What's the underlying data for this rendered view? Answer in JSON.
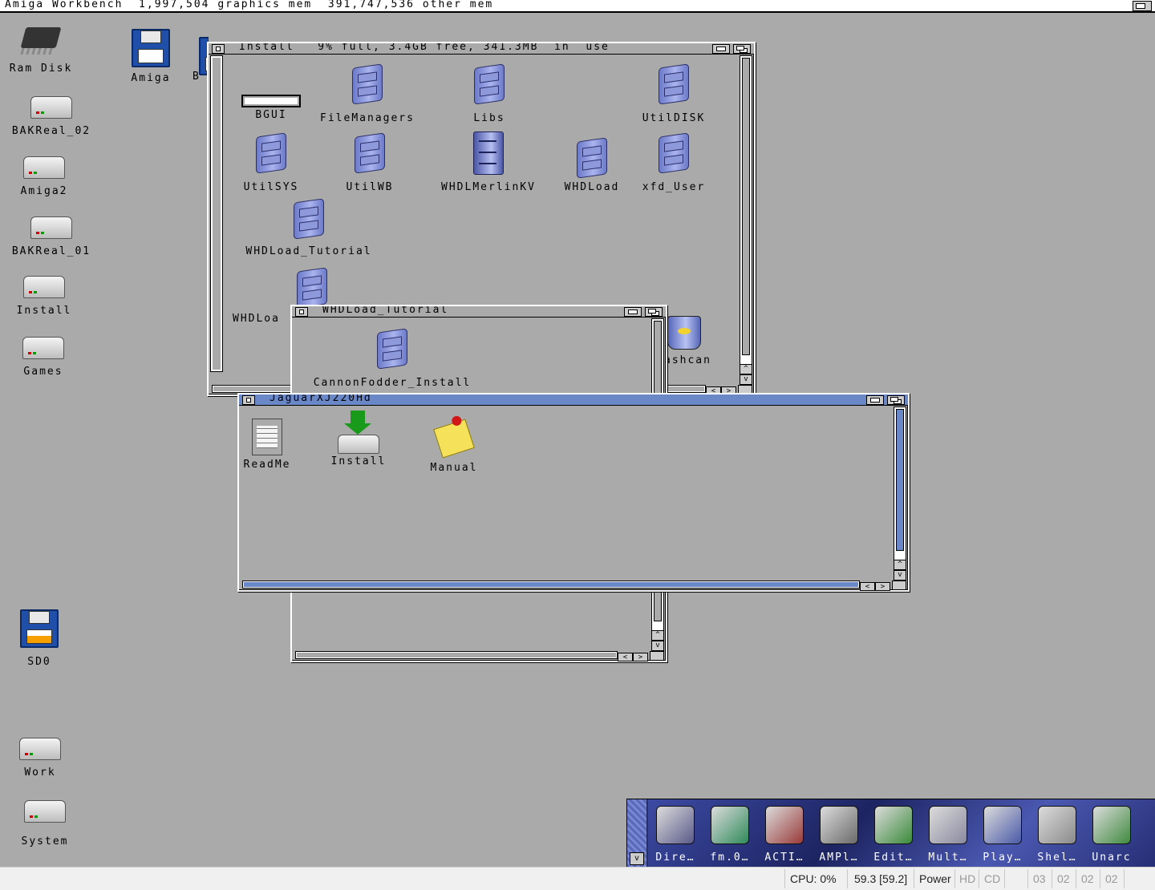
{
  "screen": {
    "title": "Amiga Workbench  1,997,504 graphics mem  391,747,536 other mem"
  },
  "desktop_icons": [
    {
      "label": "Ram Disk",
      "kind": "ram"
    },
    {
      "label": "Amiga",
      "kind": "floppy"
    },
    {
      "label": "B",
      "kind": "floppy"
    },
    {
      "label": "BAKReal_02",
      "kind": "drive"
    },
    {
      "label": "Amiga2",
      "kind": "drive"
    },
    {
      "label": "BAKReal_01",
      "kind": "drive"
    },
    {
      "label": "Install",
      "kind": "drive"
    },
    {
      "label": "Games",
      "kind": "drive"
    },
    {
      "label": "SD0",
      "kind": "floppy"
    },
    {
      "label": "Work",
      "kind": "drive"
    },
    {
      "label": "System",
      "kind": "drive"
    }
  ],
  "windows": {
    "install": {
      "title": "Install   9% full, 3.4GB free, 341.3MB  in  use",
      "items": [
        {
          "label": "BGUI"
        },
        {
          "label": "FileManagers"
        },
        {
          "label": "Libs"
        },
        {
          "label": "UtilDISK"
        },
        {
          "label": "UtilSYS"
        },
        {
          "label": "UtilWB"
        },
        {
          "label": "WHDLMerlinKV"
        },
        {
          "label": "WHDLoad"
        },
        {
          "label": "xfd_User"
        },
        {
          "label": "WHDLoad_Tutorial"
        },
        {
          "label": "WHDLoa"
        },
        {
          "label": "ashcan"
        }
      ]
    },
    "tutorial": {
      "title": "WHDLoad_Tutorial",
      "items": [
        {
          "label": "CannonFodder_Install"
        }
      ]
    },
    "jaguar": {
      "title": "JaguarXJ220Hd",
      "items": [
        {
          "label": "ReadMe"
        },
        {
          "label": "Install"
        },
        {
          "label": "Manual"
        }
      ]
    }
  },
  "dock": {
    "items": [
      {
        "label": "Dire…",
        "color": "#5a5a8a"
      },
      {
        "label": "fm.0…",
        "color": "#2f8a5a"
      },
      {
        "label": "ACTI…",
        "color": "#9a3a3a"
      },
      {
        "label": "AMPl…",
        "color": "#6a6a6a"
      },
      {
        "label": "Edit…",
        "color": "#3a8a3a"
      },
      {
        "label": "Mult…",
        "color": "#8a8aa0"
      },
      {
        "label": "Play…",
        "color": "#4a5aa8"
      },
      {
        "label": "Shel…",
        "color": "#8a8a8a"
      },
      {
        "label": "Unarc",
        "color": "#3f8a3f"
      }
    ]
  },
  "status": {
    "cpu": "CPU: 0%",
    "fps": "59.3 [59.2]",
    "power": "Power",
    "hd": "HD",
    "cd": "CD",
    "drives": [
      "03",
      "02",
      "02",
      "02"
    ]
  }
}
